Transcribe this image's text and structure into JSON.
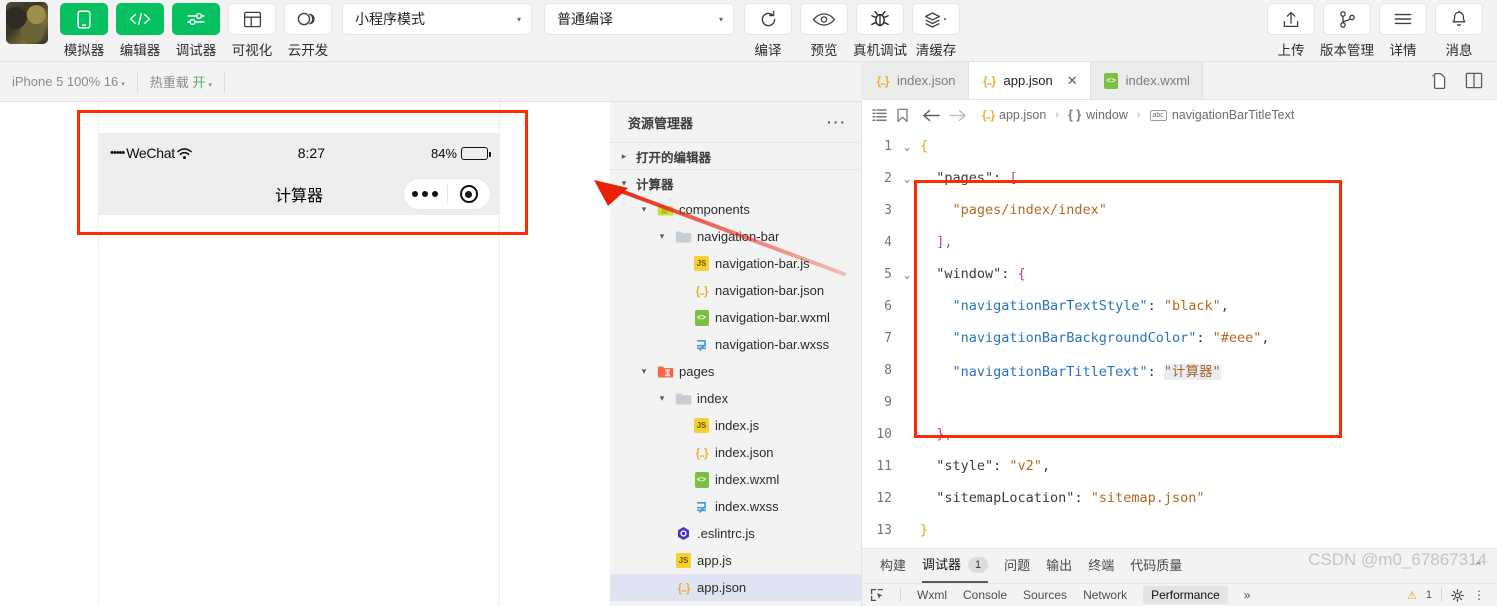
{
  "toolbar": {
    "avatar_alt": "user-avatar",
    "buttons": [
      {
        "label": "模拟器",
        "icon": "phone-icon",
        "style": "green"
      },
      {
        "label": "编辑器",
        "icon": "code-icon",
        "style": "green"
      },
      {
        "label": "调试器",
        "icon": "sliders-icon",
        "style": "green"
      },
      {
        "label": "可视化",
        "icon": "layout-icon",
        "style": "white"
      },
      {
        "label": "云开发",
        "icon": "cloud-icon",
        "style": "white"
      }
    ],
    "mode_select": {
      "value": "小程序模式",
      "caret": "▾"
    },
    "compile_select": {
      "value": "普通编译",
      "caret": "▾"
    },
    "actions": [
      {
        "label": "编译",
        "icon": "refresh-icon"
      },
      {
        "label": "预览",
        "icon": "eye-icon"
      },
      {
        "label": "真机调试",
        "icon": "bug-icon"
      },
      {
        "label": "清缓存",
        "icon": "layers-icon"
      }
    ],
    "right_actions": [
      {
        "label": "上传",
        "icon": "upload-icon"
      },
      {
        "label": "版本管理",
        "icon": "branch-icon"
      },
      {
        "label": "详情",
        "icon": "menu-icon"
      },
      {
        "label": "消息",
        "icon": "bell-icon"
      }
    ]
  },
  "subbar": {
    "device": "iPhone 5 100% 16",
    "device_caret": "▾",
    "hotreload_label": "热重载",
    "hotreload_state": "开",
    "hotreload_caret": "▾",
    "sim_icons": [
      "refresh-icon",
      "record-icon",
      "device-icon",
      "multiwindow-icon"
    ],
    "activity_icons": [
      "files-icon",
      "search-icon",
      "source-control-icon",
      "extensions-icon",
      "layout-split-icon",
      "docker-icon"
    ]
  },
  "simulator": {
    "status_bar": {
      "carrier_dots": "•••••",
      "carrier": "WeChat",
      "wifi": "wifi-icon",
      "time": "8:27",
      "battery_percent": "84%"
    },
    "nav_bar": {
      "title": "计算器",
      "capsule": "capsule-menu"
    }
  },
  "explorer": {
    "title": "资源管理器",
    "more": "···",
    "open_editors": {
      "label": "打开的编辑器",
      "twisty": "▸"
    },
    "project": {
      "label": "计算器",
      "twisty": "▾"
    },
    "tree": [
      {
        "label": "components",
        "depth": 1,
        "type": "folder-open",
        "twisty": "▾",
        "icon": "folder-components-icon"
      },
      {
        "label": "navigation-bar",
        "depth": 2,
        "type": "folder-open",
        "twisty": "▾",
        "icon": "folder-icon"
      },
      {
        "label": "navigation-bar.js",
        "depth": 3,
        "type": "file",
        "icon": "js-icon"
      },
      {
        "label": "navigation-bar.json",
        "depth": 3,
        "type": "file",
        "icon": "json-icon"
      },
      {
        "label": "navigation-bar.wxml",
        "depth": 3,
        "type": "file",
        "icon": "wxml-icon"
      },
      {
        "label": "navigation-bar.wxss",
        "depth": 3,
        "type": "file",
        "icon": "wxss-icon"
      },
      {
        "label": "pages",
        "depth": 1,
        "type": "folder-open",
        "twisty": "▾",
        "icon": "folder-pages-icon"
      },
      {
        "label": "index",
        "depth": 2,
        "type": "folder-open",
        "twisty": "▾",
        "icon": "folder-icon"
      },
      {
        "label": "index.js",
        "depth": 3,
        "type": "file",
        "icon": "js-icon"
      },
      {
        "label": "index.json",
        "depth": 3,
        "type": "file",
        "icon": "json-icon"
      },
      {
        "label": "index.wxml",
        "depth": 3,
        "type": "file",
        "icon": "wxml-icon"
      },
      {
        "label": "index.wxss",
        "depth": 3,
        "type": "file",
        "icon": "wxss-icon"
      },
      {
        "label": ".eslintrc.js",
        "depth": 2,
        "type": "file",
        "icon": "eslint-icon"
      },
      {
        "label": "app.js",
        "depth": 2,
        "type": "file",
        "icon": "js-icon"
      },
      {
        "label": "app.json",
        "depth": 2,
        "type": "file",
        "icon": "json-icon",
        "selected": true
      }
    ]
  },
  "editor": {
    "tabs": [
      {
        "label": "index.json",
        "icon": "json-icon",
        "active": false,
        "closable": false
      },
      {
        "label": "app.json",
        "icon": "json-icon",
        "active": true,
        "closable": true,
        "close": "✕"
      },
      {
        "label": "index.wxml",
        "icon": "wxml-icon",
        "active": false,
        "closable": false
      }
    ],
    "tab_actions": [
      "new-file-icon",
      "split-editor-icon"
    ],
    "breadcrumb": {
      "icons": [
        "outline-icon",
        "bookmark-icon",
        "back-arrow-icon",
        "forward-arrow-icon"
      ],
      "items": [
        {
          "label": "app.json",
          "icon": "json-icon"
        },
        {
          "label": "window",
          "icon": "object-icon"
        },
        {
          "label": "navigationBarTitleText",
          "icon": "abc-icon"
        }
      ],
      "separator": "›"
    },
    "code": {
      "language": "json",
      "lines": [
        {
          "n": "1",
          "fold": "⌄",
          "segments": [
            {
              "t": "{",
              "c": "k-brace"
            }
          ]
        },
        {
          "n": "2",
          "fold": "⌄",
          "segments": [
            {
              "t": "  \"pages\"",
              "c": "k-top"
            },
            {
              "t": ": ",
              "c": "k-top"
            },
            {
              "t": "[",
              "c": "k-brk"
            }
          ]
        },
        {
          "n": "3",
          "fold": "",
          "segments": [
            {
              "t": "    \"pages/index/index\"",
              "c": "k-str"
            }
          ]
        },
        {
          "n": "4",
          "fold": "",
          "segments": [
            {
              "t": "  ]",
              "c": "k-brk"
            },
            {
              "t": ",",
              "c": "k-brk"
            }
          ]
        },
        {
          "n": "5",
          "fold": "⌄",
          "segments": [
            {
              "t": "  \"window\"",
              "c": "k-top"
            },
            {
              "t": ": ",
              "c": "k-top"
            },
            {
              "t": "{",
              "c": "k-brk"
            }
          ]
        },
        {
          "n": "6",
          "fold": "",
          "segments": [
            {
              "t": "    \"navigationBarTextStyle\"",
              "c": "k-key"
            },
            {
              "t": ": ",
              "c": "k-top"
            },
            {
              "t": "\"black\"",
              "c": "k-str"
            },
            {
              "t": ",",
              "c": "k-top"
            }
          ]
        },
        {
          "n": "7",
          "fold": "",
          "segments": [
            {
              "t": "    \"navigationBarBackgroundColor\"",
              "c": "k-key"
            },
            {
              "t": ": ",
              "c": "k-top"
            },
            {
              "t": "\"#eee\"",
              "c": "k-str"
            },
            {
              "t": ",",
              "c": "k-top"
            }
          ]
        },
        {
          "n": "8",
          "fold": "",
          "segments": [
            {
              "t": "    \"navigationBarTitleText\"",
              "c": "k-key"
            },
            {
              "t": ": ",
              "c": "k-top"
            },
            {
              "t": "\"计算器\"",
              "c": "k-str sel"
            }
          ]
        },
        {
          "n": "9",
          "fold": "",
          "segments": []
        },
        {
          "n": "10",
          "fold": "",
          "segments": [
            {
              "t": "  }",
              "c": "k-brk"
            },
            {
              "t": ",",
              "c": "k-brk"
            }
          ]
        },
        {
          "n": "11",
          "fold": "",
          "segments": [
            {
              "t": "  \"style\"",
              "c": "k-top"
            },
            {
              "t": ": ",
              "c": "k-top"
            },
            {
              "t": "\"v2\"",
              "c": "k-str"
            },
            {
              "t": ",",
              "c": "k-top"
            }
          ]
        },
        {
          "n": "12",
          "fold": "",
          "segments": [
            {
              "t": "  \"sitemapLocation\"",
              "c": "k-top"
            },
            {
              "t": ": ",
              "c": "k-top"
            },
            {
              "t": "\"sitemap.json\"",
              "c": "k-str"
            }
          ]
        },
        {
          "n": "13",
          "fold": "",
          "segments": [
            {
              "t": "}",
              "c": "k-brace"
            }
          ]
        }
      ]
    }
  },
  "panel": {
    "tabs": [
      {
        "label": "构建",
        "active": false
      },
      {
        "label": "调试器",
        "active": true,
        "badge": "1"
      },
      {
        "label": "问题",
        "active": false
      },
      {
        "label": "输出",
        "active": false
      },
      {
        "label": "终端",
        "active": false
      },
      {
        "label": "代码质量",
        "active": false
      }
    ],
    "collapse": "⌃",
    "devtools": {
      "inspect_icon": "inspect-icon",
      "tabs": [
        {
          "label": "Wxml",
          "active": false
        },
        {
          "label": "Console",
          "active": false
        },
        {
          "label": "Sources",
          "active": false
        },
        {
          "label": "Network",
          "active": false
        },
        {
          "label": "Performance",
          "active": true
        }
      ],
      "overflow": "»",
      "warning_count": "1",
      "warning_icon": "warning-icon",
      "settings_icon": "settings-icon",
      "more_icon": "more-vertical-icon"
    }
  },
  "annotations": {
    "watermark": "CSDN @m0_67867314",
    "highlight_color": "#fc2b05",
    "arrow_color": "#e81f09"
  }
}
